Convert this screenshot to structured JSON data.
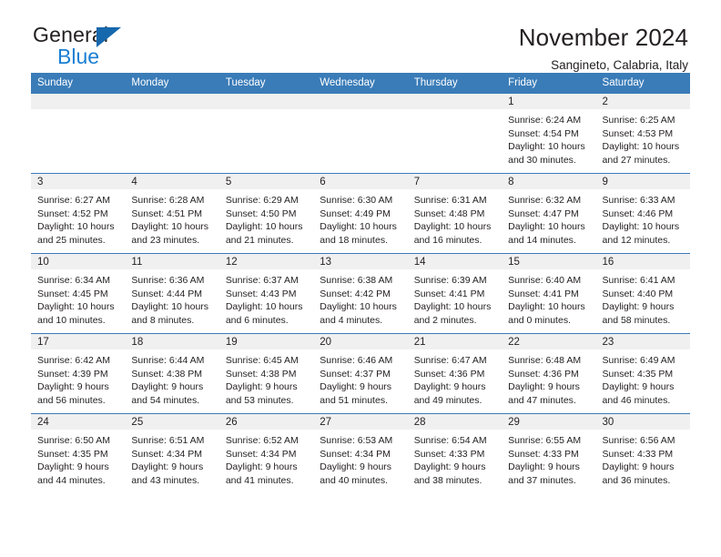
{
  "brand": {
    "name_part1": "General",
    "name_part2": "Blue",
    "logo_icon": "triangle-logo-icon"
  },
  "header": {
    "title": "November 2024",
    "subtitle": "Sangineto, Calabria, Italy"
  },
  "colors": {
    "header_blue": "#3a7cb8",
    "brand_blue": "#1a7fd4",
    "day_band_gray": "#f0f0f0",
    "text": "#231f20"
  },
  "calendar": {
    "day_headers": [
      "Sunday",
      "Monday",
      "Tuesday",
      "Wednesday",
      "Thursday",
      "Friday",
      "Saturday"
    ],
    "weeks": [
      [
        {
          "date": "",
          "lines": []
        },
        {
          "date": "",
          "lines": []
        },
        {
          "date": "",
          "lines": []
        },
        {
          "date": "",
          "lines": []
        },
        {
          "date": "",
          "lines": []
        },
        {
          "date": "1",
          "lines": [
            "Sunrise: 6:24 AM",
            "Sunset: 4:54 PM",
            "Daylight: 10 hours",
            "and 30 minutes."
          ]
        },
        {
          "date": "2",
          "lines": [
            "Sunrise: 6:25 AM",
            "Sunset: 4:53 PM",
            "Daylight: 10 hours",
            "and 27 minutes."
          ]
        }
      ],
      [
        {
          "date": "3",
          "lines": [
            "Sunrise: 6:27 AM",
            "Sunset: 4:52 PM",
            "Daylight: 10 hours",
            "and 25 minutes."
          ]
        },
        {
          "date": "4",
          "lines": [
            "Sunrise: 6:28 AM",
            "Sunset: 4:51 PM",
            "Daylight: 10 hours",
            "and 23 minutes."
          ]
        },
        {
          "date": "5",
          "lines": [
            "Sunrise: 6:29 AM",
            "Sunset: 4:50 PM",
            "Daylight: 10 hours",
            "and 21 minutes."
          ]
        },
        {
          "date": "6",
          "lines": [
            "Sunrise: 6:30 AM",
            "Sunset: 4:49 PM",
            "Daylight: 10 hours",
            "and 18 minutes."
          ]
        },
        {
          "date": "7",
          "lines": [
            "Sunrise: 6:31 AM",
            "Sunset: 4:48 PM",
            "Daylight: 10 hours",
            "and 16 minutes."
          ]
        },
        {
          "date": "8",
          "lines": [
            "Sunrise: 6:32 AM",
            "Sunset: 4:47 PM",
            "Daylight: 10 hours",
            "and 14 minutes."
          ]
        },
        {
          "date": "9",
          "lines": [
            "Sunrise: 6:33 AM",
            "Sunset: 4:46 PM",
            "Daylight: 10 hours",
            "and 12 minutes."
          ]
        }
      ],
      [
        {
          "date": "10",
          "lines": [
            "Sunrise: 6:34 AM",
            "Sunset: 4:45 PM",
            "Daylight: 10 hours",
            "and 10 minutes."
          ]
        },
        {
          "date": "11",
          "lines": [
            "Sunrise: 6:36 AM",
            "Sunset: 4:44 PM",
            "Daylight: 10 hours",
            "and 8 minutes."
          ]
        },
        {
          "date": "12",
          "lines": [
            "Sunrise: 6:37 AM",
            "Sunset: 4:43 PM",
            "Daylight: 10 hours",
            "and 6 minutes."
          ]
        },
        {
          "date": "13",
          "lines": [
            "Sunrise: 6:38 AM",
            "Sunset: 4:42 PM",
            "Daylight: 10 hours",
            "and 4 minutes."
          ]
        },
        {
          "date": "14",
          "lines": [
            "Sunrise: 6:39 AM",
            "Sunset: 4:41 PM",
            "Daylight: 10 hours",
            "and 2 minutes."
          ]
        },
        {
          "date": "15",
          "lines": [
            "Sunrise: 6:40 AM",
            "Sunset: 4:41 PM",
            "Daylight: 10 hours",
            "and 0 minutes."
          ]
        },
        {
          "date": "16",
          "lines": [
            "Sunrise: 6:41 AM",
            "Sunset: 4:40 PM",
            "Daylight: 9 hours",
            "and 58 minutes."
          ]
        }
      ],
      [
        {
          "date": "17",
          "lines": [
            "Sunrise: 6:42 AM",
            "Sunset: 4:39 PM",
            "Daylight: 9 hours",
            "and 56 minutes."
          ]
        },
        {
          "date": "18",
          "lines": [
            "Sunrise: 6:44 AM",
            "Sunset: 4:38 PM",
            "Daylight: 9 hours",
            "and 54 minutes."
          ]
        },
        {
          "date": "19",
          "lines": [
            "Sunrise: 6:45 AM",
            "Sunset: 4:38 PM",
            "Daylight: 9 hours",
            "and 53 minutes."
          ]
        },
        {
          "date": "20",
          "lines": [
            "Sunrise: 6:46 AM",
            "Sunset: 4:37 PM",
            "Daylight: 9 hours",
            "and 51 minutes."
          ]
        },
        {
          "date": "21",
          "lines": [
            "Sunrise: 6:47 AM",
            "Sunset: 4:36 PM",
            "Daylight: 9 hours",
            "and 49 minutes."
          ]
        },
        {
          "date": "22",
          "lines": [
            "Sunrise: 6:48 AM",
            "Sunset: 4:36 PM",
            "Daylight: 9 hours",
            "and 47 minutes."
          ]
        },
        {
          "date": "23",
          "lines": [
            "Sunrise: 6:49 AM",
            "Sunset: 4:35 PM",
            "Daylight: 9 hours",
            "and 46 minutes."
          ]
        }
      ],
      [
        {
          "date": "24",
          "lines": [
            "Sunrise: 6:50 AM",
            "Sunset: 4:35 PM",
            "Daylight: 9 hours",
            "and 44 minutes."
          ]
        },
        {
          "date": "25",
          "lines": [
            "Sunrise: 6:51 AM",
            "Sunset: 4:34 PM",
            "Daylight: 9 hours",
            "and 43 minutes."
          ]
        },
        {
          "date": "26",
          "lines": [
            "Sunrise: 6:52 AM",
            "Sunset: 4:34 PM",
            "Daylight: 9 hours",
            "and 41 minutes."
          ]
        },
        {
          "date": "27",
          "lines": [
            "Sunrise: 6:53 AM",
            "Sunset: 4:34 PM",
            "Daylight: 9 hours",
            "and 40 minutes."
          ]
        },
        {
          "date": "28",
          "lines": [
            "Sunrise: 6:54 AM",
            "Sunset: 4:33 PM",
            "Daylight: 9 hours",
            "and 38 minutes."
          ]
        },
        {
          "date": "29",
          "lines": [
            "Sunrise: 6:55 AM",
            "Sunset: 4:33 PM",
            "Daylight: 9 hours",
            "and 37 minutes."
          ]
        },
        {
          "date": "30",
          "lines": [
            "Sunrise: 6:56 AM",
            "Sunset: 4:33 PM",
            "Daylight: 9 hours",
            "and 36 minutes."
          ]
        }
      ]
    ]
  }
}
